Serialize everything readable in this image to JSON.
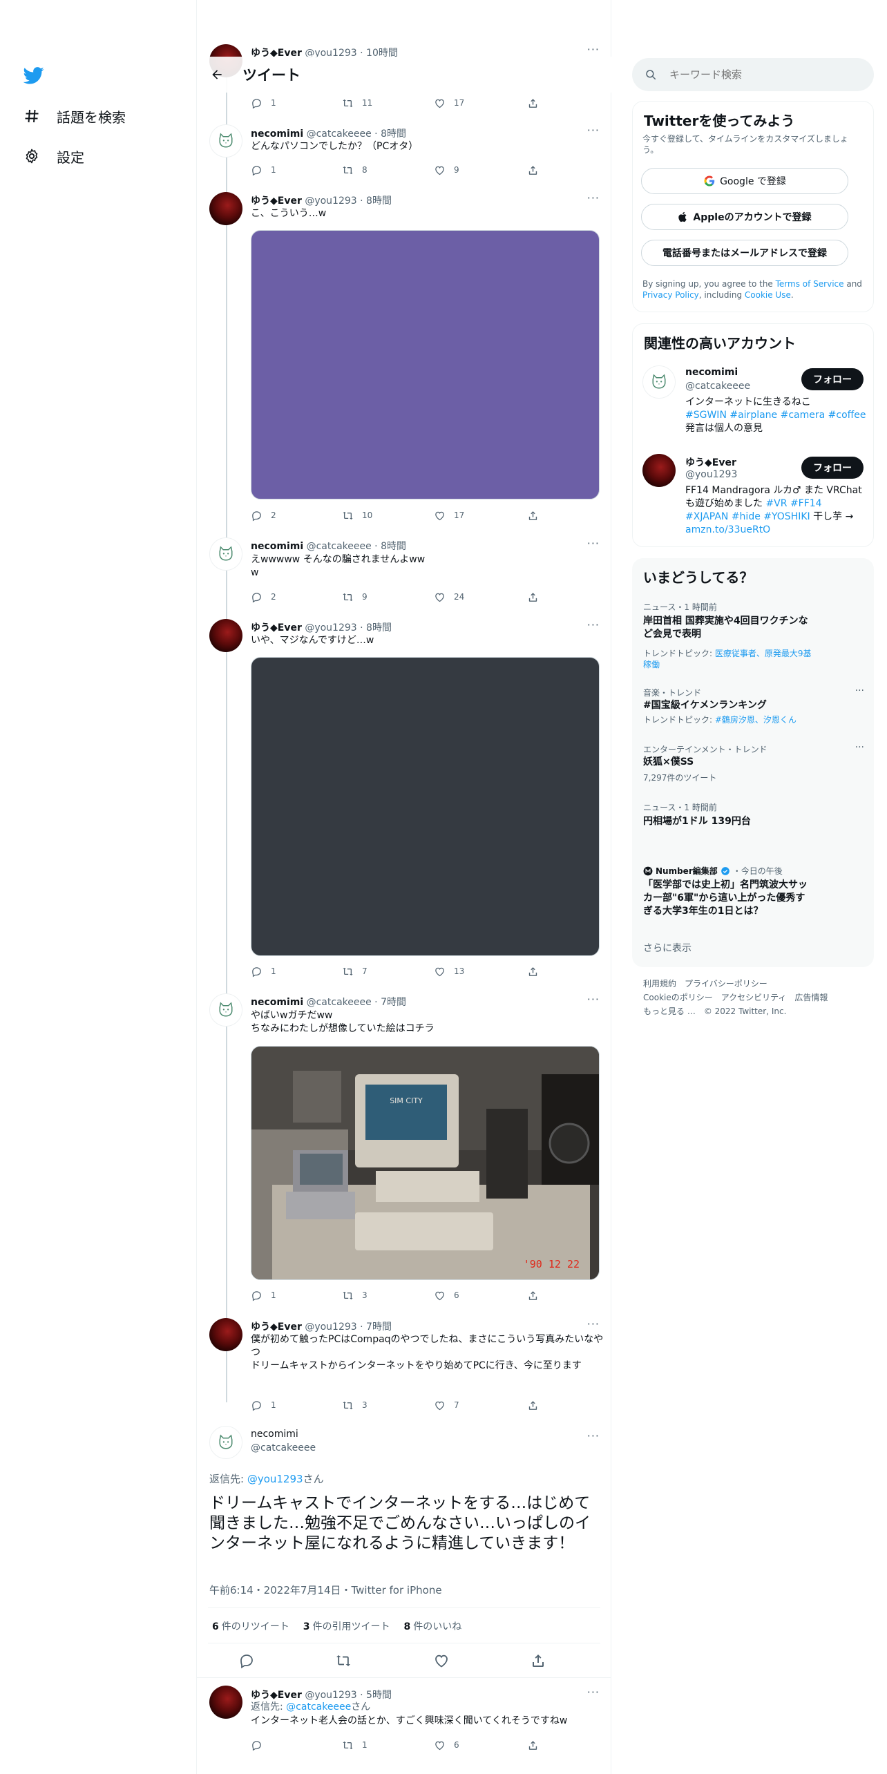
{
  "nav": {
    "logo": "twitter-bird-icon",
    "items": [
      {
        "label": "話題を検索",
        "icon": "hashtag-icon"
      },
      {
        "label": "設定",
        "icon": "gear-icon"
      }
    ]
  },
  "header": {
    "title": "ツイート",
    "back_icon": "arrow-left-icon"
  },
  "tweets": [
    {
      "name": "ゆう◆Ever",
      "handle": "@you1293",
      "time": "10時間",
      "reply": "1",
      "retweet": "11",
      "like": "17"
    },
    {
      "name": "necomimi",
      "handle": "@catcakeeee",
      "time": "8時間",
      "text": "どんなパソコンでしたか？（PCオタ）",
      "reply": "1",
      "retweet": "8",
      "like": "9"
    },
    {
      "name": "ゆう◆Ever",
      "handle": "@you1293",
      "time": "8時間",
      "text": "こ、こういう…w",
      "reply": "2",
      "retweet": "10",
      "like": "17"
    },
    {
      "name": "necomimi",
      "handle": "@catcakeeee",
      "time": "8時間",
      "text": "えwwwww そんなの騙されませんよww\nw",
      "reply": "2",
      "retweet": "9",
      "like": "24"
    },
    {
      "name": "ゆう◆Ever",
      "handle": "@you1293",
      "time": "8時間",
      "text": "いや、マジなんですけど…w",
      "reply": "1",
      "retweet": "7",
      "like": "13"
    },
    {
      "name": "necomimi",
      "handle": "@catcakeeee",
      "time": "7時間",
      "text": "やばいwガチだww\nちなみにわたしが想像していた絵はコチラ",
      "reply": "1",
      "retweet": "3",
      "like": "6",
      "photo_date": "'90 12 22",
      "photo_screen": "SIM CITY"
    },
    {
      "name": "ゆう◆Ever",
      "handle": "@you1293",
      "time": "7時間",
      "text": "僕が初めて触ったPCはCompaqのやつでしたね、まさにこういう写真みたいなやつ\nドリームキャストからインターネットをやり始めてPCに行き、今に至ります",
      "reply": "1",
      "retweet": "3",
      "like": "7"
    }
  ],
  "focal": {
    "name": "necomimi",
    "handle": "@catcakeeee",
    "reply_prefix": "返信先: ",
    "reply_to": "@you1293",
    "reply_suffix": "さん",
    "text": "ドリームキャストでインターネットをする…はじめて聞きました…勉強不足でごめんなさい…いっぱしのインターネット屋になれるように精進していきます！",
    "meta": "午前6:14・2022年7月14日・Twitter for iPhone",
    "retweets_count": "6",
    "retweets_label": "件のリツイート",
    "quotes_count": "3",
    "quotes_label": "件の引用ツイート",
    "likes_count": "8",
    "likes_label": "件のいいね"
  },
  "reply_tweet": {
    "name": "ゆう◆Ever",
    "handle": "@you1293",
    "time": "5時間",
    "reply_prefix": "返信先: ",
    "reply_to": "@catcakeeee",
    "reply_suffix": "さん",
    "text": "インターネット老人会の話とか、すごく興味深く聞いてくれそうですねw",
    "retweet": "1",
    "like": "6"
  },
  "right": {
    "search_placeholder": "キーワード検索",
    "signup": {
      "title": "Twitterを使ってみよう",
      "subtitle": "今すぐ登録して、タイムラインをカスタマイズしましょう。",
      "google": "Google で登録",
      "apple": "Appleのアカウントで登録",
      "phone": "電話番号またはメールアドレスで登録",
      "legal_1": "By signing up, you agree to the ",
      "terms": "Terms of Service",
      "legal_2": " and ",
      "privacy": "Privacy Policy",
      "legal_3": ", including ",
      "cookie": "Cookie Use",
      "legal_4": "."
    },
    "accounts": {
      "title": "関連性の高いアカウント",
      "follow_label": "フォロー",
      "items": [
        {
          "name": "necomimi",
          "handle": "@catcakeeee",
          "bio_1": "インターネットに生きるねこ",
          "tags_1": "#SGWIN #airplane #camera #coffee",
          "bio_2": "発言は個人の意見"
        },
        {
          "name": "ゆう◆Ever",
          "handle": "@you1293",
          "bio_1": "FF14 Mandragora ルカ♂ また VRChatも遊び始めました ",
          "tags_1": "#VR #FF14 #XJAPAN #hide #YOSHIKI",
          "bio_2": " 干し芋 → ",
          "link": "amzn.to/33ueRtO"
        }
      ]
    },
    "trends": {
      "title": "いまどうしてる？",
      "items": [
        {
          "cat": "ニュース・1 時間前",
          "title": "岸田首相 国葬実施や4回目ワクチンなど会見で表明",
          "sub_prefix": "トレンドトピック: ",
          "sub_links": "医療従事者、原発最大9基稼働"
        },
        {
          "cat": "音楽・トレンド",
          "title": "#国宝級イケメンランキング",
          "sub_prefix": "トレンドトピック: ",
          "sub_links": "#鶴房汐恩、汐恩くん"
        },
        {
          "cat": "エンターテインメント・トレンド",
          "title": "妖狐×僕SS",
          "sub": "7,297件のツイート"
        },
        {
          "cat": "ニュース・1 時間前",
          "title": "円相場が1ドル 139円台"
        },
        {
          "source": "Number編集部",
          "cat": "今日の午後",
          "title": "「医学部では史上初」名門筑波大サッカー部\"6軍\"から這い上がった優秀すぎる大学3年生の1日とは？"
        }
      ],
      "more": "さらに表示"
    },
    "footer": {
      "line1": "利用規約　プライバシーポリシー",
      "line2": "Cookieのポリシー　アクセシビリティ　広告情報",
      "line3": "もっと見る …　© 2022 Twitter, Inc."
    }
  }
}
